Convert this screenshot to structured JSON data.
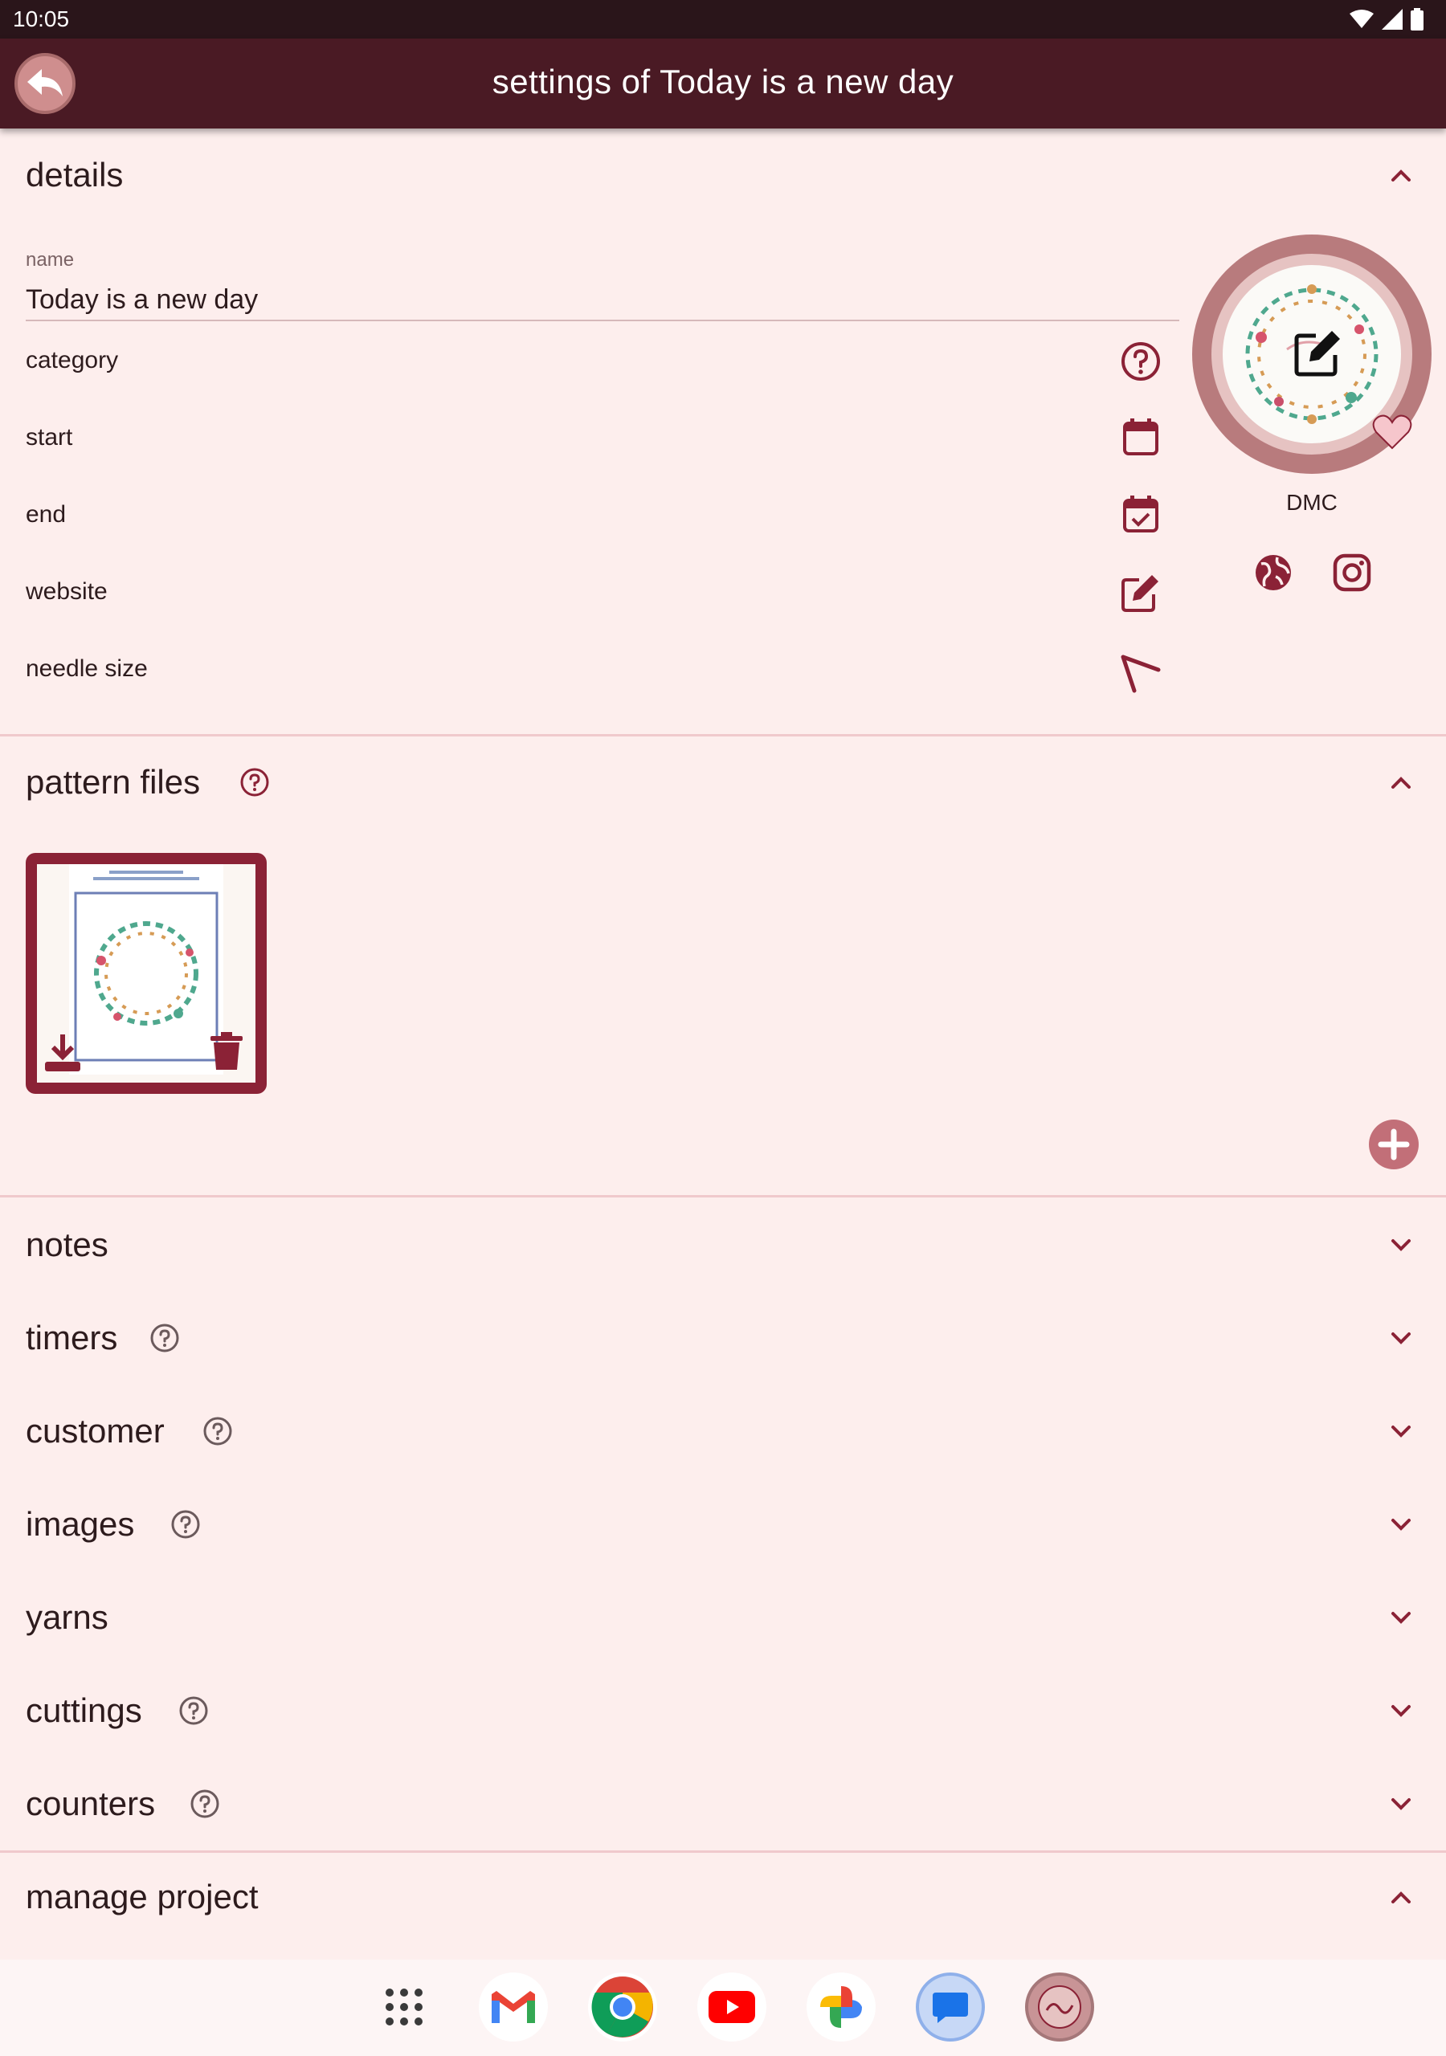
{
  "status_bar": {
    "time": "10:05"
  },
  "app_bar": {
    "title": "settings of Today is a new day"
  },
  "details": {
    "title": "details",
    "name_caption": "name",
    "name_value": "Today is a new day",
    "rows": [
      "category",
      "start",
      "end",
      "website",
      "needle size"
    ],
    "brand": "DMC"
  },
  "pattern_files": {
    "title": "pattern files"
  },
  "sections": [
    {
      "label": "notes"
    },
    {
      "label": "timers"
    },
    {
      "label": "customer"
    },
    {
      "label": "images"
    },
    {
      "label": "yarns"
    },
    {
      "label": "cuttings"
    },
    {
      "label": "counters"
    }
  ],
  "manage_project": {
    "title": "manage project"
  },
  "colors": {
    "primary": "#8b2236",
    "appbar": "#4a1a24",
    "background": "#fdeeed",
    "divider": "#f0c9cc"
  },
  "dock_apps": [
    "app-drawer-icon",
    "gmail-icon",
    "chrome-icon",
    "youtube-icon",
    "photos-icon",
    "messages-icon",
    "project-stitch-icon"
  ]
}
